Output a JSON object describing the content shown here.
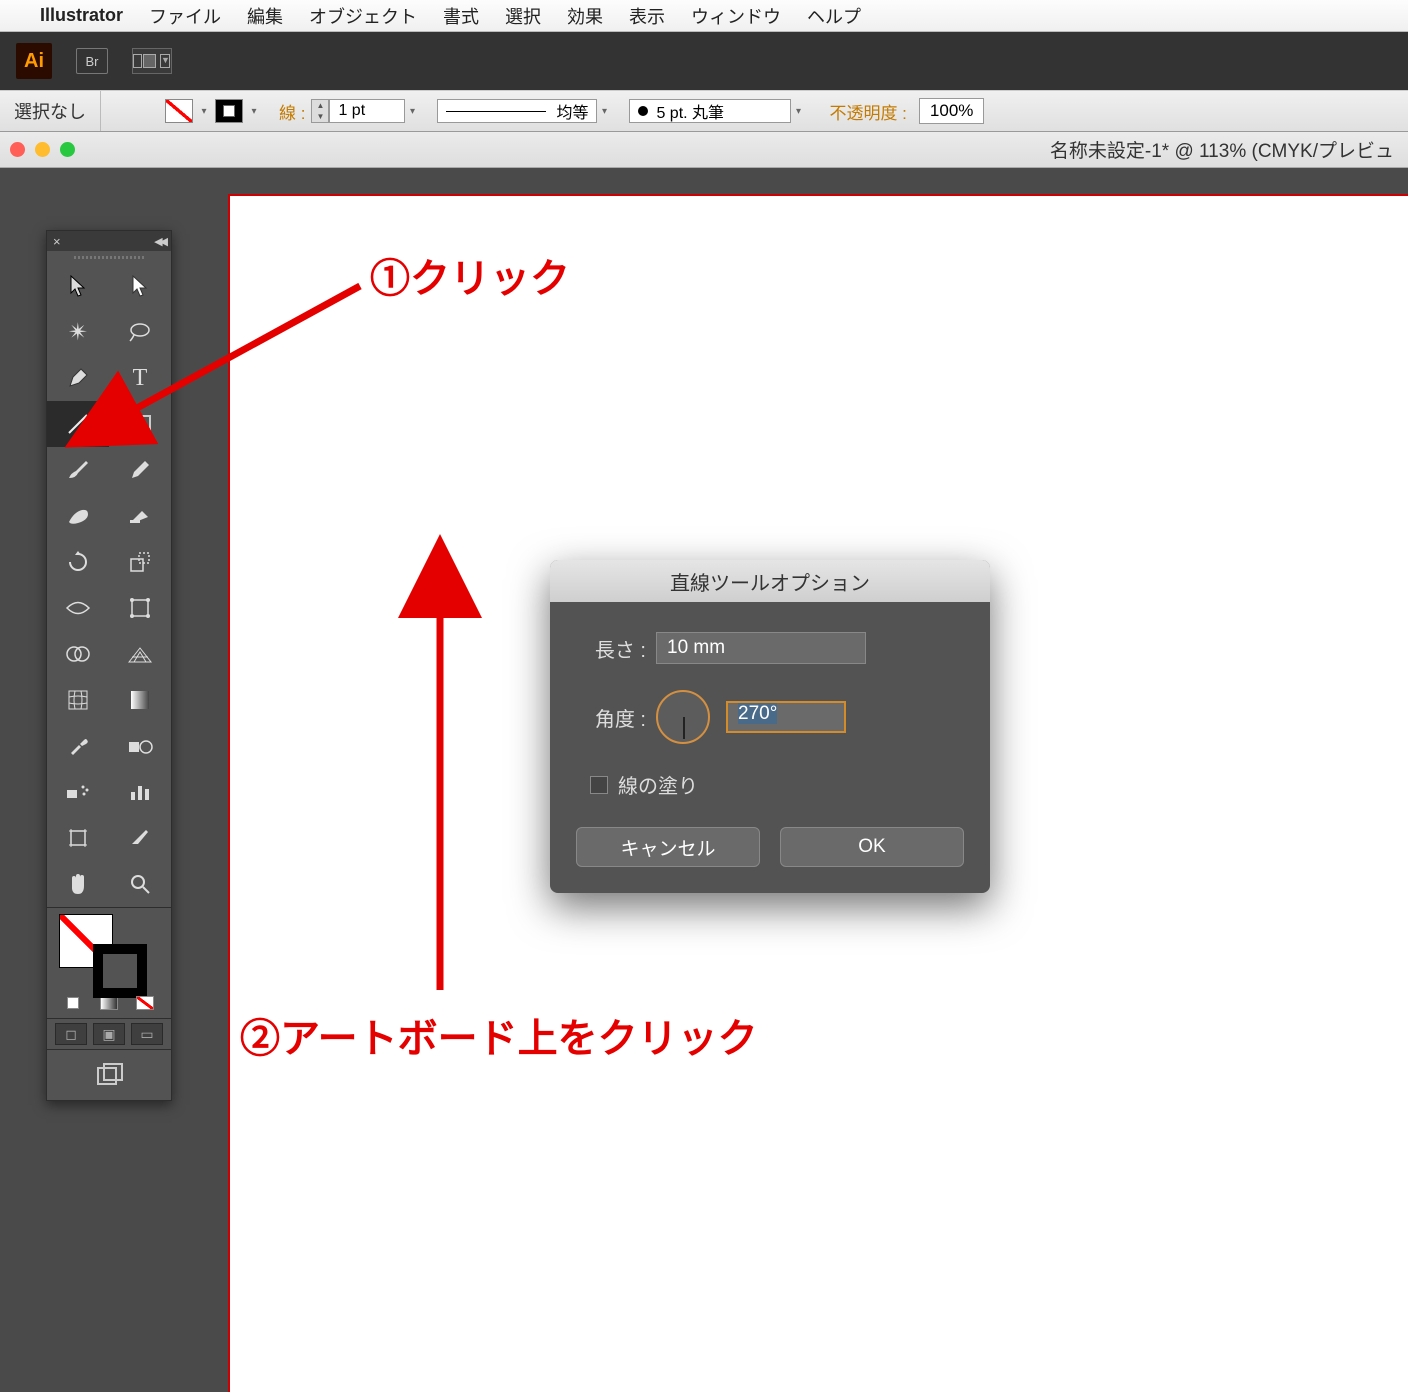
{
  "menubar": {
    "app": "Illustrator",
    "items": [
      "ファイル",
      "編集",
      "オブジェクト",
      "書式",
      "選択",
      "効果",
      "表示",
      "ウィンドウ",
      "ヘルプ"
    ]
  },
  "appbar": {
    "logo": "Ai",
    "bridge": "Br"
  },
  "ctrlbar": {
    "selection": "選択なし",
    "stroke_label": "線 :",
    "stroke_weight": "1 pt",
    "stroke_profile": "均等",
    "brush": "5 pt. 丸筆",
    "opacity_label": "不透明度 :",
    "opacity": "100%"
  },
  "doc": {
    "title": "名称未設定-1* @ 113% (CMYK/プレビュ"
  },
  "dialog": {
    "title": "直線ツールオプション",
    "length_label": "長さ :",
    "length_value": "10 mm",
    "angle_label": "角度 :",
    "angle_value": "270°",
    "fill_line_label": "線の塗り",
    "cancel": "キャンセル",
    "ok": "OK"
  },
  "annotations": {
    "a1": "①クリック",
    "a2": "②アートボード上をクリック"
  }
}
